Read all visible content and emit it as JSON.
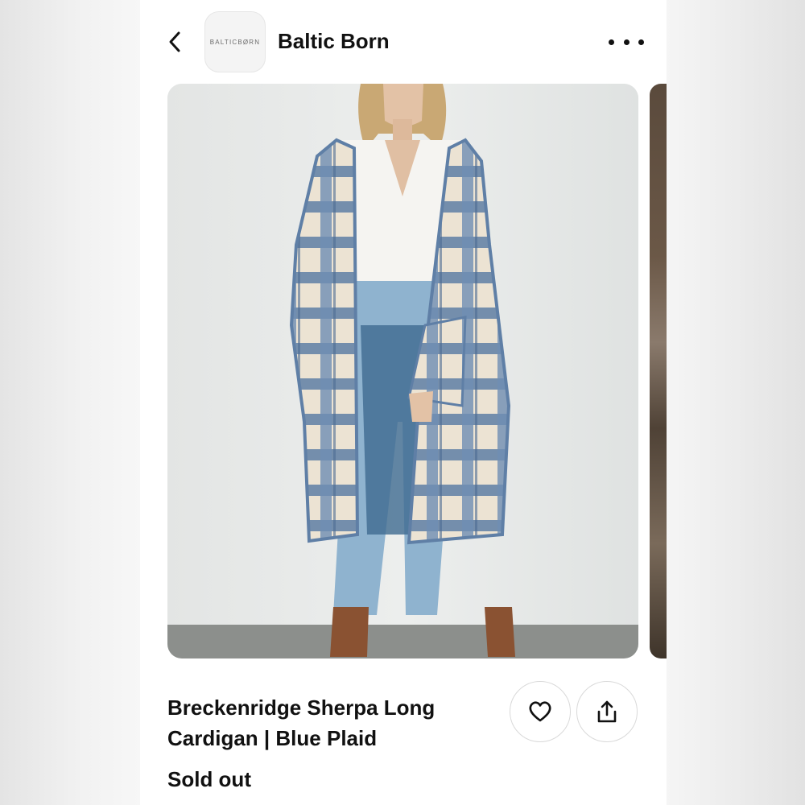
{
  "header": {
    "brand_name": "Baltic Born",
    "logo_text": "BALTICBØRN",
    "back_icon": "chevron-left-icon",
    "more_icon": "more-horizontal-icon"
  },
  "product": {
    "title_line1": "Breckenridge Sherpa Long",
    "title_line2": "Cardigan | Blue Plaid",
    "status": "Sold out",
    "save_icon": "heart-icon",
    "share_icon": "share-icon"
  },
  "colors": {
    "background": "#ffffff",
    "text": "#111111",
    "button_border": "#d9d9d9"
  }
}
